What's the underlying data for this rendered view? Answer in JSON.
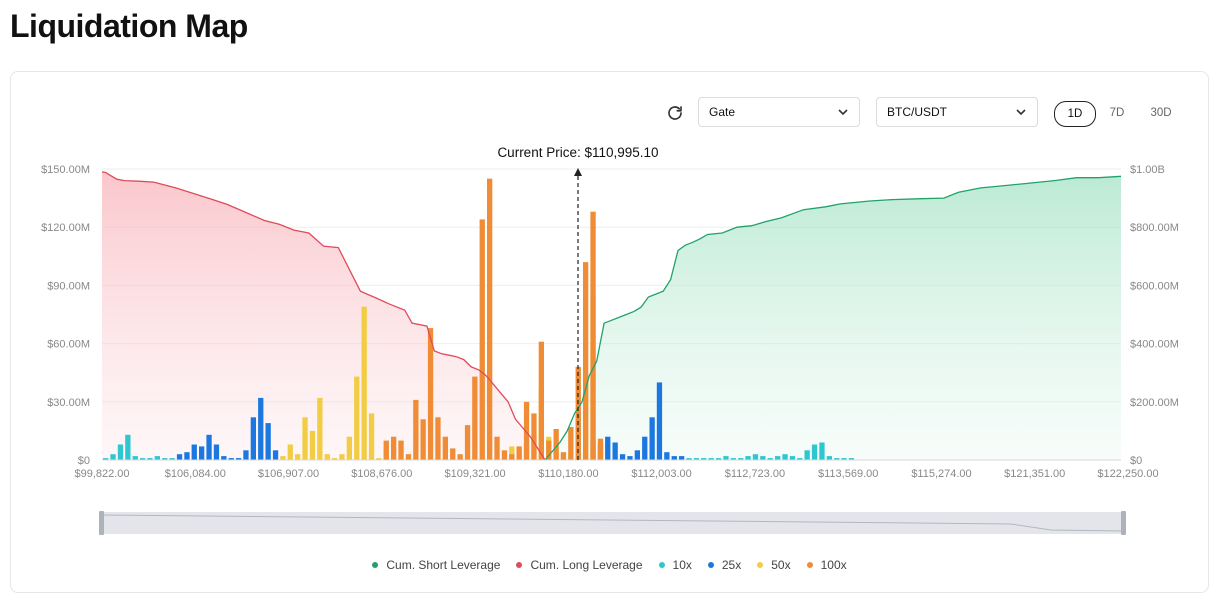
{
  "page": {
    "title": "Liquidation Map"
  },
  "controls": {
    "exchange": "Gate",
    "pair": "BTC/USDT",
    "ranges": [
      "1D",
      "7D",
      "30D"
    ],
    "active_range": "1D",
    "refresh_icon": "refresh-icon"
  },
  "colors": {
    "short": "#20a36a",
    "long": "#e04b5b",
    "10x": "#2ec6d1",
    "25x": "#1c78e0",
    "50x": "#f2cc45",
    "100x": "#ef8c35"
  },
  "chart_data": {
    "type": "bar",
    "current_price_label": "Current Price: $110,995.10",
    "current_price": 110995.1,
    "x_tick_labels": [
      "$99,822.00",
      "$106,084.00",
      "$106,907.00",
      "$108,676.00",
      "$109,321.00",
      "$110,180.00",
      "$112,003.00",
      "$112,723.00",
      "$113,569.00",
      "$115,274.00",
      "$121,351.00",
      "$122,250.00"
    ],
    "y_left": {
      "ticks": [
        "$0",
        "$30.00M",
        "$60.00M",
        "$90.00M",
        "$120.00M",
        "$150.00M"
      ],
      "ylim": [
        0,
        150
      ]
    },
    "y_right": {
      "ticks": [
        "$0",
        "$200.00M",
        "$400.00M",
        "$600.00M",
        "$800.00M",
        "$1.00B"
      ],
      "ylim": [
        0,
        1000
      ]
    },
    "bar_series": [
      {
        "name": "10x",
        "bars": [
          [
            0,
            1
          ],
          [
            1,
            3
          ],
          [
            2,
            8
          ],
          [
            3,
            13
          ],
          [
            4,
            2
          ],
          [
            5,
            1
          ],
          [
            6,
            1
          ],
          [
            7,
            2
          ],
          [
            8,
            1
          ],
          [
            9,
            1
          ],
          [
            79,
            1
          ],
          [
            80,
            1
          ],
          [
            81,
            1
          ],
          [
            82,
            1
          ],
          [
            83,
            1
          ],
          [
            84,
            2
          ],
          [
            85,
            1
          ],
          [
            86,
            1
          ],
          [
            87,
            2
          ],
          [
            88,
            3
          ],
          [
            89,
            2
          ],
          [
            90,
            1
          ],
          [
            91,
            2
          ],
          [
            92,
            3
          ],
          [
            93,
            2
          ],
          [
            94,
            1
          ],
          [
            95,
            5
          ],
          [
            96,
            8
          ],
          [
            97,
            9
          ],
          [
            98,
            2
          ],
          [
            99,
            1
          ],
          [
            100,
            1
          ],
          [
            101,
            1
          ]
        ]
      },
      {
        "name": "25x",
        "bars": [
          [
            10,
            3
          ],
          [
            11,
            4
          ],
          [
            12,
            8
          ],
          [
            13,
            7
          ],
          [
            14,
            13
          ],
          [
            15,
            8
          ],
          [
            16,
            2
          ],
          [
            17,
            1
          ],
          [
            18,
            1
          ],
          [
            19,
            5
          ],
          [
            20,
            22
          ],
          [
            21,
            32
          ],
          [
            22,
            19
          ],
          [
            23,
            5
          ],
          [
            66,
            10
          ],
          [
            67,
            8
          ],
          [
            68,
            12
          ],
          [
            69,
            9
          ],
          [
            70,
            3
          ],
          [
            71,
            2
          ],
          [
            72,
            5
          ],
          [
            73,
            12
          ],
          [
            74,
            22
          ],
          [
            75,
            40
          ],
          [
            76,
            4
          ],
          [
            77,
            2
          ],
          [
            78,
            2
          ]
        ]
      },
      {
        "name": "50x",
        "bars": [
          [
            24,
            2
          ],
          [
            25,
            8
          ],
          [
            26,
            3
          ],
          [
            27,
            22
          ],
          [
            28,
            15
          ],
          [
            29,
            32
          ],
          [
            30,
            3
          ],
          [
            31,
            1
          ],
          [
            32,
            3
          ],
          [
            33,
            12
          ],
          [
            34,
            43
          ],
          [
            35,
            79
          ],
          [
            36,
            24
          ],
          [
            37,
            1
          ],
          [
            38,
            7
          ],
          [
            55,
            7
          ],
          [
            56,
            4
          ],
          [
            57,
            9
          ],
          [
            58,
            11
          ],
          [
            59,
            37
          ],
          [
            60,
            12
          ],
          [
            61,
            4
          ],
          [
            62,
            1
          ],
          [
            63,
            3
          ],
          [
            64,
            22
          ],
          [
            65,
            43
          ],
          [
            66,
            85
          ]
        ]
      },
      {
        "name": "100x",
        "bars": [
          [
            38,
            10
          ],
          [
            39,
            12
          ],
          [
            40,
            10
          ],
          [
            41,
            3
          ],
          [
            42,
            31
          ],
          [
            43,
            21
          ],
          [
            44,
            68
          ],
          [
            45,
            22
          ],
          [
            46,
            12
          ],
          [
            47,
            6
          ],
          [
            48,
            3
          ],
          [
            49,
            18
          ],
          [
            50,
            43
          ],
          [
            51,
            124
          ],
          [
            52,
            145
          ],
          [
            53,
            12
          ],
          [
            54,
            5
          ],
          [
            55,
            3
          ],
          [
            56,
            7
          ],
          [
            57,
            30
          ],
          [
            58,
            24
          ],
          [
            59,
            61
          ],
          [
            60,
            10
          ],
          [
            61,
            16
          ],
          [
            62,
            4
          ],
          [
            63,
            17
          ],
          [
            64,
            48
          ],
          [
            65,
            102
          ],
          [
            66,
            128
          ],
          [
            67,
            11
          ]
        ]
      }
    ],
    "line_series": [
      {
        "name": "Cum. Long Leverage",
        "axis": "right",
        "x": [
          0,
          0.5,
          1,
          2,
          3,
          5,
          7,
          10,
          15,
          17,
          20,
          22,
          24,
          26,
          28,
          30,
          32,
          35,
          37,
          39,
          41,
          42,
          44,
          45,
          46,
          47,
          48,
          49,
          50,
          51,
          52,
          53,
          54,
          55,
          56,
          57,
          58,
          59,
          60
        ],
        "y": [
          990,
          988,
          980,
          965,
          960,
          958,
          955,
          935,
          895,
          878,
          845,
          823,
          810,
          790,
          780,
          735,
          730,
          580,
          558,
          535,
          515,
          470,
          460,
          375,
          365,
          360,
          355,
          345,
          320,
          310,
          290,
          260,
          230,
          200,
          140,
          110,
          80,
          40,
          0
        ]
      },
      {
        "name": "Cum. Short Leverage",
        "axis": "right",
        "x": [
          60,
          62,
          63,
          64,
          65,
          66,
          67,
          68,
          69,
          70,
          71,
          72,
          73,
          74,
          75,
          76,
          77,
          78,
          79,
          80,
          81,
          82,
          84,
          86,
          88,
          90,
          92,
          95,
          98,
          100,
          104,
          107,
          111,
          114,
          116,
          119,
          121,
          125,
          129,
          132,
          135,
          138
        ],
        "y": [
          0,
          60,
          100,
          160,
          200,
          290,
          340,
          470,
          480,
          490,
          500,
          510,
          525,
          560,
          570,
          580,
          620,
          720,
          738,
          748,
          760,
          775,
          780,
          800,
          805,
          820,
          832,
          860,
          870,
          880,
          890,
          895,
          898,
          900,
          920,
          935,
          940,
          950,
          960,
          970,
          970,
          975
        ]
      }
    ],
    "legend": [
      "Cum. Short Leverage",
      "Cum. Long Leverage",
      "10x",
      "25x",
      "50x",
      "100x"
    ]
  }
}
